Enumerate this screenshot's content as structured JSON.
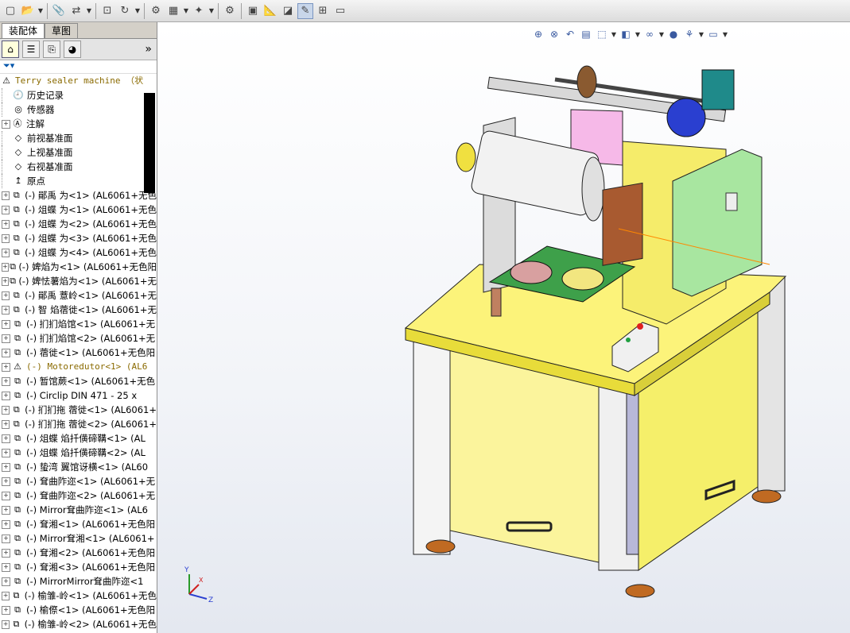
{
  "tabs": [
    {
      "label": "装配体"
    },
    {
      "label": "草图"
    }
  ],
  "tree": {
    "root": "Terry sealer machine （状",
    "items": [
      {
        "label": "历史记录"
      },
      {
        "label": "传感器"
      },
      {
        "label": "注解"
      },
      {
        "label": "前视基准面"
      },
      {
        "label": "上视基准面"
      },
      {
        "label": "右视基准面"
      },
      {
        "label": "原点"
      }
    ],
    "parts": [
      "(-) 鄖禹 为<1> (AL6061+无色",
      "(-) 俎蝶 为<1> (AL6061+无色",
      "(-) 俎蝶 为<2> (AL6061+无色",
      "(-) 俎蝶 为<3> (AL6061+无色",
      "(-) 俎蝶 为<4> (AL6061+无色",
      "(-) 婢焰为<1> (AL6061+无色阳",
      "(-) 婢怯薯焰为<1> (AL6061+无",
      "(-) 鄖禹 薏岭<1> (AL6061+无",
      "(-) 智 焰蓿徙<1> (AL6061+无",
      "(-) 扪扪焰馆<1> (AL6061+无",
      "(-) 扪扪焰馆<2> (AL6061+无",
      "(-) 蓿徙<1> (AL6061+无色阳",
      "(-) Motoredutor<1> (AL6",
      "(-) 暂馆蕨<1> (AL6061+无色",
      "(-) Circlip DIN 471 - 25 x",
      "(-) 扪扪拖 蓿徙<1> (AL6061+",
      "(-) 扪扪拖 蓿徙<2> (AL6061+",
      "(-) 俎蝶 焰扦僙碲鞲<1> (AL",
      "(-) 俎蝶 焰扦僙碲鞲<2> (AL",
      "(-) 蛰湾 翼馆讶横<1> (AL60",
      "(-) 耷曲阼迩<1> (AL6061+无",
      "(-) 耷曲阼迩<2> (AL6061+无",
      "(-) Mirror耷曲阼迩<1> (AL6",
      "(-) 耷湘<1> (AL6061+无色阳",
      "(-) Mirror耷湘<1> (AL6061+",
      "(-) 耷湘<2> (AL6061+无色阳",
      "(-) 耷湘<3> (AL6061+无色阳",
      "(-) MirrorMirror耷曲阼迩<1",
      "(-) 榆雏-岭<1> (AL6061+无色",
      "(-) 榆傺<1> (AL6061+无色阳",
      "(-) 榆雏-岭<2> (AL6061+无色"
    ]
  },
  "axes": {
    "x": "X",
    "y": "Y",
    "z": "Z"
  },
  "colors": {
    "frame_yellow": "#f5f07a",
    "panel_green": "#a8e6a0",
    "motor_blue": "#2a3fd0",
    "foot_brown": "#c0702a"
  }
}
